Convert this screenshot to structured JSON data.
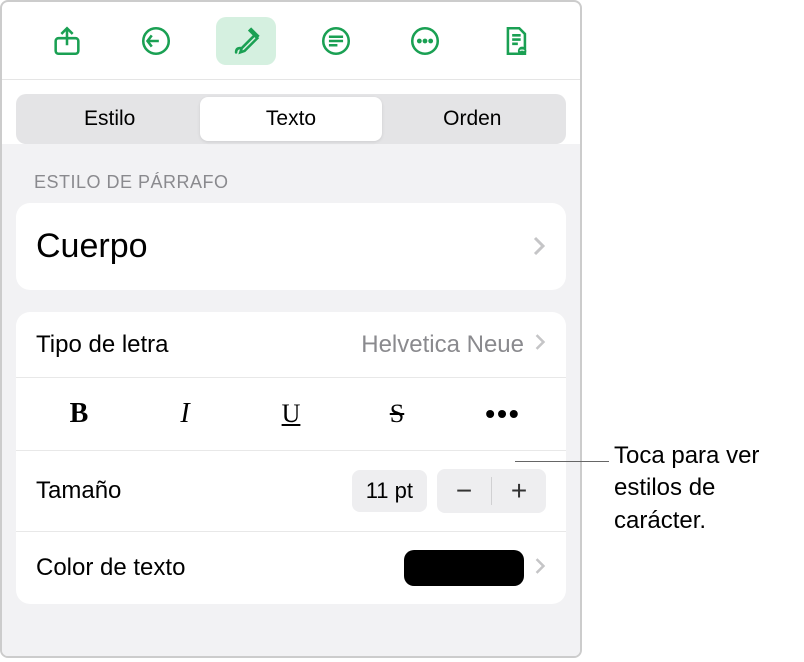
{
  "tabs": {
    "style": "Estilo",
    "text": "Texto",
    "order": "Orden"
  },
  "sections": {
    "paragraph_style": "ESTILO DE PÁRRAFO"
  },
  "paragraph": {
    "body": "Cuerpo"
  },
  "font": {
    "label": "Tipo de letra",
    "value": "Helvetica Neue"
  },
  "format": {
    "bold": "B",
    "italic": "I",
    "underline": "U",
    "strike": "S",
    "more": "•••"
  },
  "size": {
    "label": "Tamaño",
    "value": "11 pt",
    "minus": "−",
    "plus": "+"
  },
  "textcolor": {
    "label": "Color de texto",
    "hex": "#000000"
  },
  "callout": {
    "text": "Toca para ver estilos de carácter."
  },
  "colors": {
    "accent": "#1aa053"
  }
}
